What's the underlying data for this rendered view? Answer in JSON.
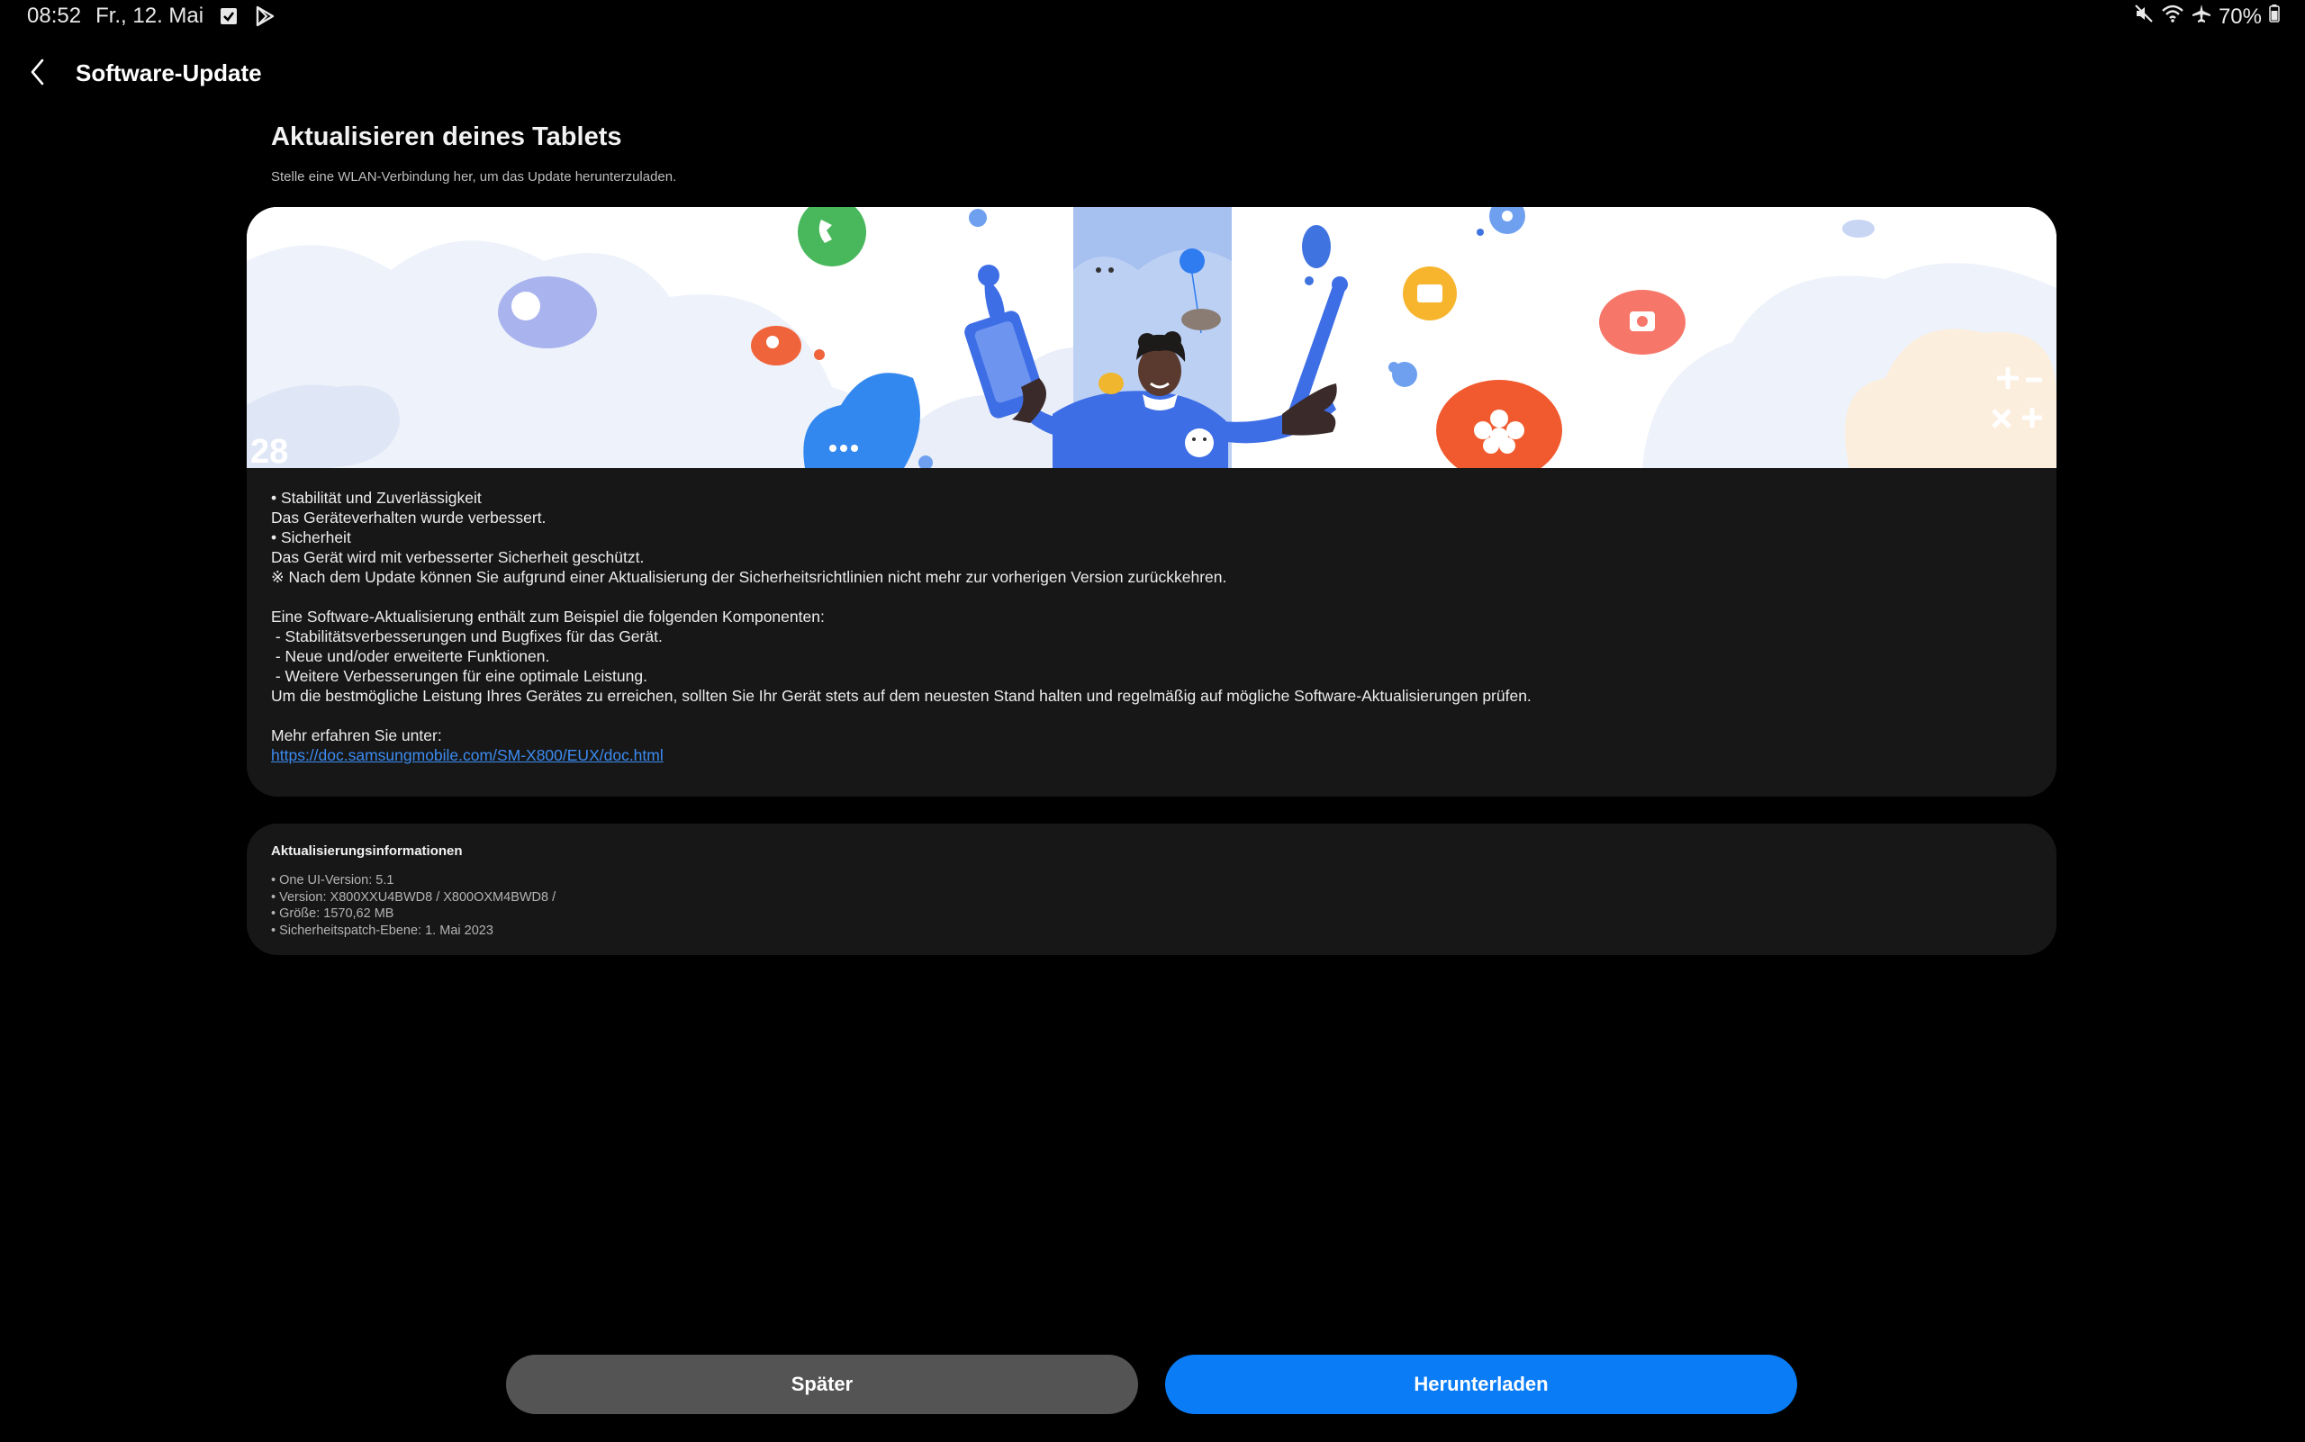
{
  "status_bar": {
    "time": "08:52",
    "date": "Fr., 12. Mai",
    "battery": "70%",
    "left_icons": [
      "checkbox-notification-icon",
      "play-store-icon"
    ],
    "right_icons": [
      "mute-icon",
      "wifi-icon",
      "airplane-mode-icon",
      "battery-icon"
    ]
  },
  "app_bar": {
    "title": "Software-Update",
    "back_icon": "chevron-left-icon"
  },
  "page": {
    "title": "Aktualisieren deines Tablets",
    "subtitle": "Stelle eine WLAN-Verbindung her, um das Update herunterzuladen."
  },
  "release_notes": {
    "lines": [
      "• Stabilität und Zuverlässigkeit",
      "Das Geräteverhalten wurde verbessert.",
      "• Sicherheit",
      "Das Gerät wird mit verbesserter Sicherheit geschützt.",
      "※ Nach dem Update können Sie aufgrund einer Aktualisierung der Sicherheitsrichtlinien nicht mehr zur vorherigen Version zurückkehren.",
      "Eine Software-Aktualisierung enthält zum Beispiel die folgenden Komponenten:",
      " - Stabilitätsverbesserungen und Bugfixes für das Gerät.",
      " - Neue und/oder erweiterte Funktionen.",
      " - Weitere Verbesserungen für eine optimale Leistung.",
      "Um die bestmögliche Leistung Ihres Gerätes zu erreichen, sollten Sie Ihr Gerät stets auf dem neuesten Stand halten und regelmäßig auf mögliche Software-Aktualisierungen prüfen.",
      "Mehr erfahren Sie unter:"
    ],
    "link": "https://doc.samsungmobile.com/SM-X800/EUX/doc.html"
  },
  "update_info": {
    "title": "Aktualisierungsinformationen",
    "items": [
      "• One UI-Version: 5.1",
      "• Version: X800XXU4BWD8 / X800OXM4BWD8 /",
      "• Größe: 1570,62 MB",
      "• Sicherheitspatch-Ebene: 1. Mai 2023"
    ]
  },
  "buttons": {
    "later": "Später",
    "download": "Herunterladen"
  },
  "colors": {
    "background": "#000000",
    "card": "#171717",
    "link": "#3c8bf0",
    "primary_button": "#0a7cf6",
    "secondary_button": "#545454"
  }
}
